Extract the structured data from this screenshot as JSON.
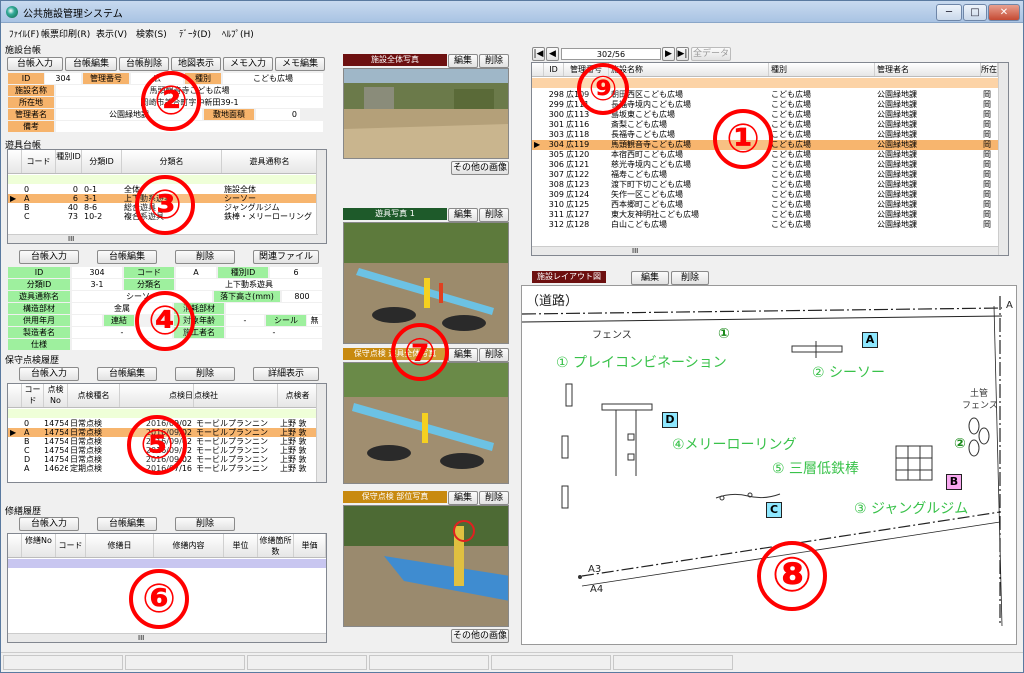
{
  "app": {
    "title": "公共施設管理システム"
  },
  "window_controls": {
    "minimize": "─",
    "maximize": "□",
    "close": "✕"
  },
  "menu": [
    "ﾌｧｲﾙ(F)",
    "帳票印刷(R)",
    "表示(V)",
    "検索(S)",
    "ﾃﾞｰﾀ(D)",
    "ﾍﾙﾌﾟ(H)"
  ],
  "facility": {
    "section_title": "施設台帳",
    "buttons": [
      "台帳入力",
      "台帳編集",
      "台帳削除",
      "地図表示",
      "メモ入力",
      "メモ編集"
    ],
    "id_label": "ID",
    "id_value": "304",
    "mgmt_label": "管理番号",
    "mgmt_value": "広",
    "type_label": "種別",
    "type_value": "こども広場",
    "name_label": "施設名称",
    "name_value": "馬頭観音寺こども広場",
    "addr_label": "所在地",
    "addr_value": "岡崎市美合町字中新田39-1",
    "manager_label": "管理者名",
    "manager_value": "公園緑地課",
    "area_label": "敷地面積",
    "area_value": "0",
    "note_label": "備考",
    "note_value": ""
  },
  "equip_list": {
    "section_title": "遊具台帳",
    "headers": [
      "コード",
      "種別ID",
      "分類ID",
      "分類名",
      "遊具通称名"
    ],
    "rows": [
      {
        "code": "0",
        "tid": "0",
        "cid": "0-1",
        "cname": "全体",
        "alias": "施設全体",
        "selected": false
      },
      {
        "code": "A",
        "tid": "6",
        "cid": "3-1",
        "cname": "上下動系遊具",
        "alias": "シーソー",
        "selected": true
      },
      {
        "code": "B",
        "tid": "40",
        "cid": "8-6",
        "cname": "総合遊具",
        "alias": "ジャングルジム",
        "selected": false
      },
      {
        "code": "C",
        "tid": "73",
        "cid": "10-2",
        "cname": "複合系遊具",
        "alias": "鉄棒・メリーローリング",
        "selected": false
      }
    ],
    "scroll_mark": "III"
  },
  "equip_detail": {
    "buttons": [
      "台帳入力",
      "台帳編集",
      "削除",
      "関連ファイル"
    ],
    "id_label": "ID",
    "id_value": "304",
    "code_label": "コード",
    "code_value": "A",
    "tid_label": "種別ID",
    "tid_value": "6",
    "cid_label": "分類ID",
    "cid_value": "3-1",
    "cname_label": "分類名",
    "cname_value": "上下動系遊具",
    "alias_label": "遊具通称名",
    "alias_value": "シーソー",
    "fall_label": "落下高さ(mm)",
    "fall_value": "800",
    "struct_label": "構造部材",
    "struct_value": "金属",
    "consume_label": "消耗部材",
    "consume_value": "",
    "year_label": "供用年月",
    "year_value": "",
    "coop_label": "連結",
    "target_label": "対象年齢",
    "target_value": "-",
    "seal_label": "シール",
    "seal_value": "無",
    "maker_label": "製造者名",
    "maker_value": "-",
    "install_label": "施工者名",
    "install_value": "-",
    "spec_label": "仕様",
    "spec_value": ""
  },
  "inspection": {
    "section_title": "保守点検履歴",
    "buttons": [
      "台帳入力",
      "台帳編集",
      "削除",
      "詳細表示"
    ],
    "headers": [
      "コード",
      "点検No",
      "点検種名",
      "点検日",
      "点検社",
      "点検者"
    ],
    "rows": [
      {
        "code": "0",
        "no": "14754",
        "kind": "日常点検",
        "date": "2016/09/02",
        "co": "モービルプランニン",
        "who": "上野 敦",
        "selected": false
      },
      {
        "code": "A",
        "no": "14754",
        "kind": "日常点検",
        "date": "2016/09/02",
        "co": "モービルプランニン",
        "who": "上野 敦",
        "selected": true
      },
      {
        "code": "B",
        "no": "14754",
        "kind": "日常点検",
        "date": "2016/09/02",
        "co": "モービルプランニン",
        "who": "上野 敦",
        "selected": false
      },
      {
        "code": "C",
        "no": "14754",
        "kind": "日常点検",
        "date": "2016/09/02",
        "co": "モービルプランニン",
        "who": "上野 敦",
        "selected": false
      },
      {
        "code": "D",
        "no": "14754",
        "kind": "日常点検",
        "date": "2016/09/02",
        "co": "モービルプランニン",
        "who": "上野 敦",
        "selected": false
      },
      {
        "code": "A",
        "no": "14626",
        "kind": "定期点検",
        "date": "2016/07/16",
        "co": "モービルプランニン",
        "who": "上野 敦",
        "selected": false
      }
    ]
  },
  "repair": {
    "section_title": "修繕履歴",
    "buttons": [
      "台帳入力",
      "台帳編集",
      "削除"
    ],
    "headers": [
      "修繕No",
      "コード",
      "修繕日",
      "修繕内容",
      "単位",
      "修繕箇所数",
      "単価"
    ],
    "scroll_mark": "III"
  },
  "photos": {
    "overall": {
      "title": "施設全体写真",
      "edit": "編集",
      "delete": "削除"
    },
    "other1": "その他の画像",
    "equip": {
      "title": "遊具写真 1",
      "edit": "編集",
      "delete": "削除"
    },
    "maint_whole": {
      "title": "保守点検 遊具全体写真",
      "edit": "編集",
      "delete": "削除"
    },
    "maint_part": {
      "title": "保守点検 部位写真",
      "edit": "編集",
      "delete": "削除"
    },
    "other2": "その他の画像"
  },
  "facility_list": {
    "nav_pos": "302/56",
    "nav_first": "|◀",
    "nav_prev": "◀",
    "nav_next": "▶",
    "nav_last": "▶|",
    "all_data": "全データ",
    "headers": [
      "ID",
      "管理番号",
      "施設名称",
      "種別",
      "管理者名",
      "所在"
    ],
    "rows": [
      {
        "id": "298",
        "no": "広109",
        "name": "朝田西区こども広場",
        "type": "こども広場",
        "mgr": "公園緑地課",
        "loc": "岡",
        "selected": false
      },
      {
        "id": "299",
        "no": "広111",
        "name": "長福寺境内こども広場",
        "type": "こども広場",
        "mgr": "公園緑地課",
        "loc": "岡",
        "selected": false
      },
      {
        "id": "300",
        "no": "広113",
        "name": "島坂東こども広場",
        "type": "こども広場",
        "mgr": "公園緑地課",
        "loc": "岡",
        "selected": false
      },
      {
        "id": "301",
        "no": "広116",
        "name": "斎梨こども広場",
        "type": "こども広場",
        "mgr": "公園緑地課",
        "loc": "岡",
        "selected": false
      },
      {
        "id": "303",
        "no": "広118",
        "name": "長福寺こども広場",
        "type": "こども広場",
        "mgr": "公園緑地課",
        "loc": "岡",
        "selected": false
      },
      {
        "id": "304",
        "no": "広119",
        "name": "馬頭観音寺こども広場",
        "type": "こども広場",
        "mgr": "公園緑地課",
        "loc": "岡",
        "selected": true
      },
      {
        "id": "305",
        "no": "広120",
        "name": "本宿西町こども広場",
        "type": "こども広場",
        "mgr": "公園緑地課",
        "loc": "岡",
        "selected": false
      },
      {
        "id": "306",
        "no": "広121",
        "name": "慈光寺境内こども広場",
        "type": "こども広場",
        "mgr": "公園緑地課",
        "loc": "岡",
        "selected": false
      },
      {
        "id": "307",
        "no": "広122",
        "name": "福寿こども広場",
        "type": "こども広場",
        "mgr": "公園緑地課",
        "loc": "岡",
        "selected": false
      },
      {
        "id": "308",
        "no": "広123",
        "name": "渡下町下切こども広場",
        "type": "こども広場",
        "mgr": "公園緑地課",
        "loc": "岡",
        "selected": false
      },
      {
        "id": "309",
        "no": "広124",
        "name": "矢作一区こども広場",
        "type": "こども広場",
        "mgr": "公園緑地課",
        "loc": "岡",
        "selected": false
      },
      {
        "id": "310",
        "no": "広125",
        "name": "西本郷町こども広場",
        "type": "こども広場",
        "mgr": "公園緑地課",
        "loc": "岡",
        "selected": false
      },
      {
        "id": "311",
        "no": "広127",
        "name": "東大友神明社こども広場",
        "type": "こども広場",
        "mgr": "公園緑地課",
        "loc": "岡",
        "selected": false
      },
      {
        "id": "312",
        "no": "広128",
        "name": "白山こども広場",
        "type": "こども広場",
        "mgr": "公園緑地課",
        "loc": "岡",
        "selected": false
      }
    ],
    "scroll_mark": "III"
  },
  "layout": {
    "title": "施設レイアウト図",
    "edit": "編集",
    "delete": "削除",
    "road": "（道路）",
    "fence1": "フェンス",
    "fence2": "フェンス",
    "pipe": "土管",
    "items": [
      {
        "label": "① プレイコンビネーション"
      },
      {
        "label": "② シーソー"
      },
      {
        "label": "④メリーローリング"
      },
      {
        "label": "⑤ 三層低鉄棒"
      },
      {
        "label": "③ ジャングルジム"
      }
    ],
    "markers": [
      "A",
      "B",
      "C",
      "D"
    ],
    "circle_marks": [
      "①",
      "②"
    ],
    "corner": "A",
    "corner_a3": "A3",
    "corner_a4": "A4"
  },
  "annotations": [
    "①",
    "②",
    "③",
    "④",
    "⑤",
    "⑥",
    "⑦",
    "⑧",
    "⑨"
  ]
}
